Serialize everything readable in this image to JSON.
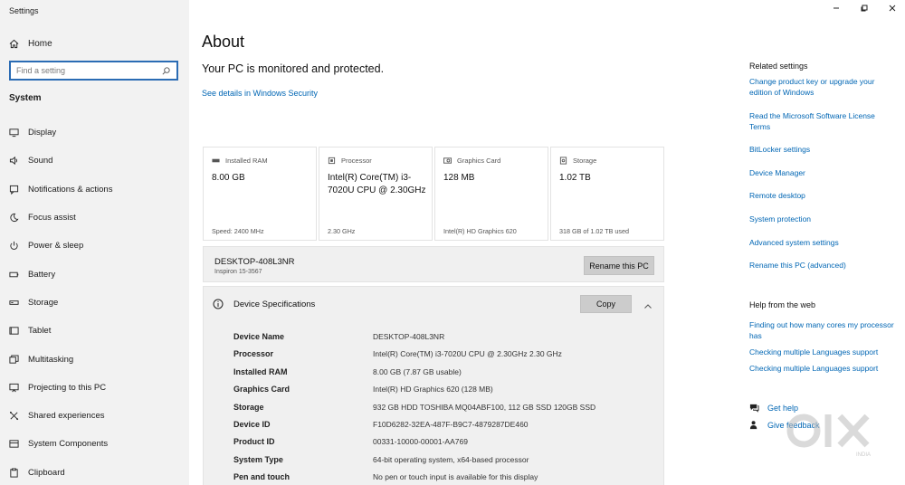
{
  "window": {
    "title": "Settings",
    "controls": [
      "minimize-icon",
      "maximize-icon",
      "close-icon"
    ]
  },
  "sidebar": {
    "home_label": "Home",
    "search_placeholder": "Find a setting",
    "section_title": "System",
    "items": [
      {
        "label": "Display",
        "icon": "monitor-icon"
      },
      {
        "label": "Sound",
        "icon": "speaker-icon"
      },
      {
        "label": "Notifications & actions",
        "icon": "notification-icon"
      },
      {
        "label": "Focus assist",
        "icon": "moon-icon"
      },
      {
        "label": "Power & sleep",
        "icon": "power-icon"
      },
      {
        "label": "Battery",
        "icon": "battery-icon"
      },
      {
        "label": "Storage",
        "icon": "storage-icon"
      },
      {
        "label": "Tablet",
        "icon": "tablet-icon"
      },
      {
        "label": "Multitasking",
        "icon": "multitasking-icon"
      },
      {
        "label": "Projecting to this PC",
        "icon": "projector-icon"
      },
      {
        "label": "Shared experiences",
        "icon": "shared-icon"
      },
      {
        "label": "System Components",
        "icon": "components-icon"
      },
      {
        "label": "Clipboard",
        "icon": "clipboard-icon"
      }
    ]
  },
  "main": {
    "title": "About",
    "protection_status": "Your PC is monitored and protected.",
    "security_link": "See details in Windows Security",
    "cards": [
      {
        "header": "Installed RAM",
        "value": "8.00 GB",
        "sub": "Speed: 2400 MHz",
        "icon": "ram-icon"
      },
      {
        "header": "Processor",
        "value": "Intel(R) Core(TM) i3-7020U CPU @ 2.30GHz",
        "sub": "2.30 GHz",
        "icon": "processor-icon"
      },
      {
        "header": "Graphics Card",
        "value": "128 MB",
        "sub": "Intel(R) HD Graphics 620",
        "icon": "graphics-card-icon"
      },
      {
        "header": "Storage",
        "value": "1.02 TB",
        "sub": "318 GB of 1.02 TB used",
        "icon": "storage-icon"
      }
    ],
    "device": {
      "name": "DESKTOP-408L3NR",
      "model": "Inspiron 15-3567",
      "rename_label": "Rename this PC"
    },
    "specs": {
      "title": "Device Specifications",
      "copy_label": "Copy",
      "rows": [
        {
          "label": "Device Name",
          "value": "DESKTOP-408L3NR"
        },
        {
          "label": "Processor",
          "value": "Intel(R) Core(TM) i3-7020U CPU @ 2.30GHz   2.30 GHz"
        },
        {
          "label": "Installed RAM",
          "value": "8.00 GB (7.87 GB usable)"
        },
        {
          "label": "Graphics Card",
          "value": "Intel(R) HD Graphics 620 (128 MB)"
        },
        {
          "label": "Storage",
          "value": "932 GB HDD TOSHIBA MQ04ABF100, 112 GB SSD 120GB SSD"
        },
        {
          "label": "Device ID",
          "value": "F10D6282-32EA-487F-B9C7-4879287DE460"
        },
        {
          "label": "Product ID",
          "value": "00331-10000-00001-AA769"
        },
        {
          "label": "System Type",
          "value": "64-bit operating system, x64-based processor"
        },
        {
          "label": "Pen and touch",
          "value": "No pen or touch input is available for this display"
        }
      ]
    }
  },
  "right": {
    "related_title": "Related settings",
    "related_links": [
      "Change product key or upgrade your edition of Windows",
      "Read the Microsoft Software License Terms",
      "BitLocker settings",
      "Device Manager",
      "Remote desktop",
      "System protection",
      "Advanced system settings",
      "Rename this PC (advanced)"
    ],
    "help_title": "Help from the web",
    "help_links": [
      "Finding out how many cores my processor has",
      "Checking multiple Languages support",
      "Checking multiple Languages support"
    ],
    "get_help": "Get help",
    "give_feedback": "Give feedback"
  },
  "watermark": {
    "brand": "OLX",
    "sub": "INDIA"
  },
  "colors": {
    "link": "#0066b4",
    "sidebar_bg": "#f2f2f2",
    "search_border": "#2b6cb4"
  }
}
